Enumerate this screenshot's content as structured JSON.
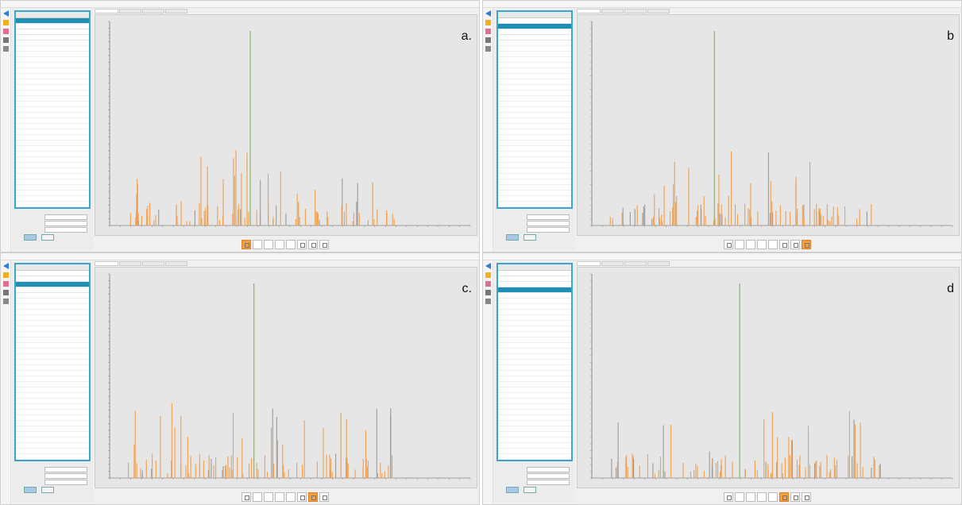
{
  "panels": [
    {
      "letter": "a.",
      "selected_row": 0,
      "selected_thumb": 0,
      "peak_x": 0.39
    },
    {
      "letter": "b",
      "selected_row": 1,
      "selected_thumb": 7,
      "peak_x": 0.34
    },
    {
      "letter": "c.",
      "selected_row": 2,
      "selected_thumb": 6,
      "peak_x": 0.4
    },
    {
      "letter": "d",
      "selected_row": 3,
      "selected_thumb": 5,
      "peak_x": 0.41
    }
  ],
  "colors": {
    "accent": "#1e8fb3",
    "peak_orange": "#f0a050",
    "peak_gray": "#9a9a9a",
    "precursor_green": "#8fbf70",
    "thumb_selected": "#f0a040"
  },
  "icons": [
    "back-arrow-icon",
    "folder-icon",
    "chart-icon",
    "save-icon",
    "export-icon"
  ]
}
